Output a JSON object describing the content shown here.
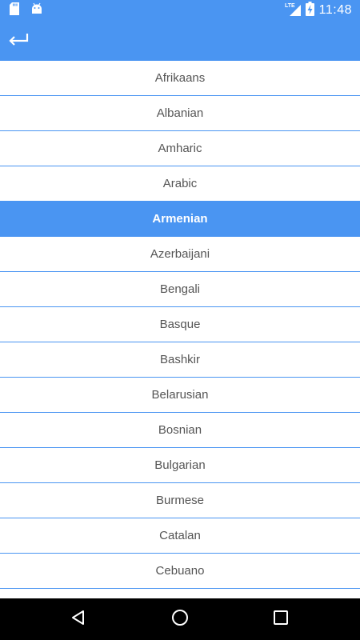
{
  "status_bar": {
    "time": "11:48",
    "network": "LTE",
    "icons": [
      "sd-card-icon",
      "android-icon",
      "lte-signal-icon",
      "battery-charging-icon"
    ]
  },
  "app_bar": {
    "back_icon": "return-arrow-icon"
  },
  "languages": [
    "Afrikaans",
    "Albanian",
    "Amharic",
    "Arabic",
    "Armenian",
    "Azerbaijani",
    "Bengali",
    "Basque",
    "Bashkir",
    "Belarusian",
    "Bosnian",
    "Bulgarian",
    "Burmese",
    "Catalan",
    "Cebuano",
    ""
  ],
  "selected_language": "Armenian",
  "nav_bar": {
    "icons": [
      "back-triangle-icon",
      "home-circle-icon",
      "recents-square-icon"
    ]
  },
  "colors": {
    "accent": "#4a95f2",
    "text": "#555555",
    "nav_background": "#000000"
  }
}
